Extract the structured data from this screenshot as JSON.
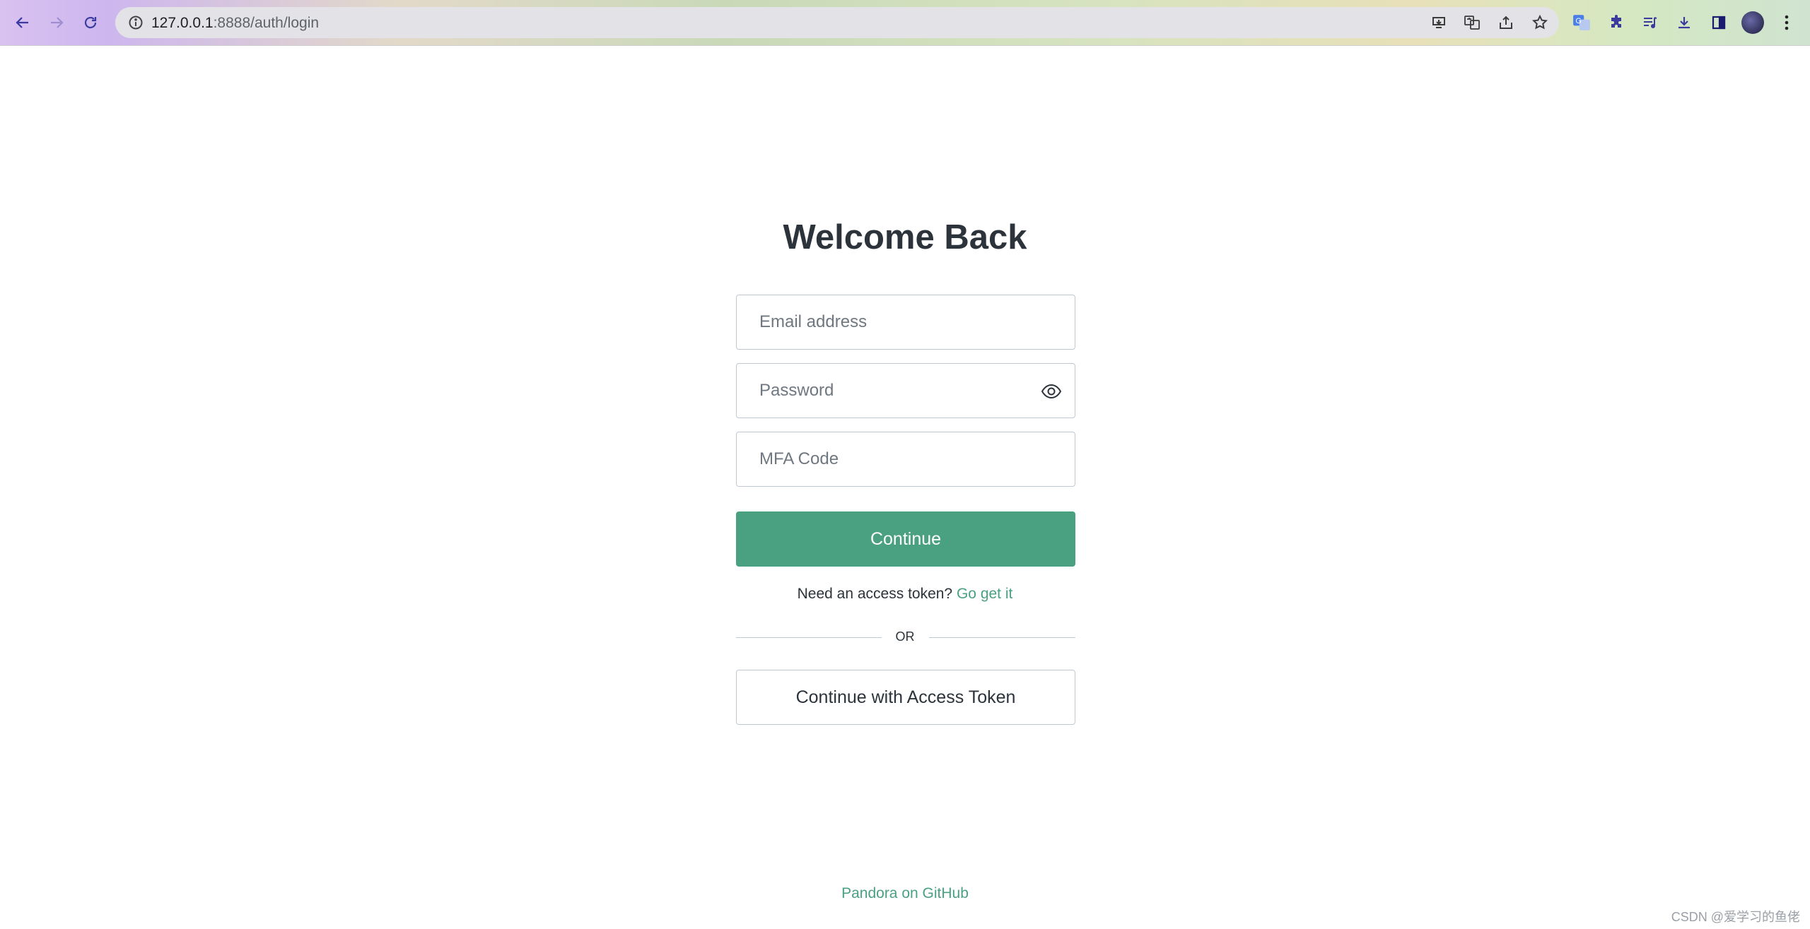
{
  "browser": {
    "url_host": "127.0.0.1",
    "url_path": ":8888/auth/login",
    "icons": [
      "back-arrow-icon",
      "forward-arrow-icon",
      "reload-icon",
      "info-icon",
      "install-icon",
      "translate-icon",
      "share-icon",
      "bookmark-star-icon",
      "translate-extension-icon",
      "puzzle-extension-icon",
      "media-queue-icon",
      "download-icon",
      "side-panel-icon",
      "profile-avatar",
      "more-vert-icon"
    ]
  },
  "login": {
    "title": "Welcome Back",
    "email_placeholder": "Email address",
    "password_placeholder": "Password",
    "mfa_placeholder": "MFA Code",
    "continue_label": "Continue",
    "need_token_text": "Need an access token?",
    "go_get_it": "Go get it",
    "or_text": "OR",
    "access_token_button": "Continue with Access Token"
  },
  "footer": {
    "github_link": "Pandora on GitHub",
    "watermark": "CSDN @爱学习的鱼佬"
  },
  "colors": {
    "accent_green": "#4aa181",
    "text_dark": "#2d333a",
    "border": "#c2c8d0"
  }
}
